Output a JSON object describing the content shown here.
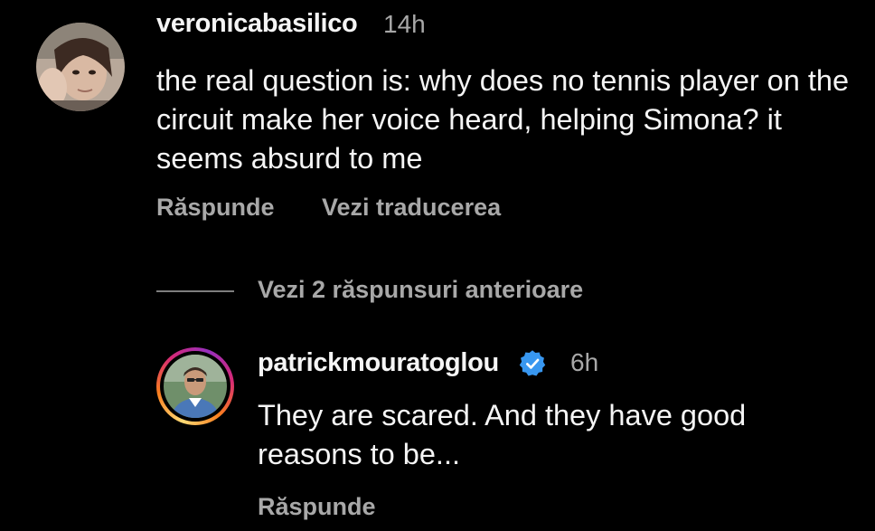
{
  "comment": {
    "username": "veronicabasilico",
    "time": "14h",
    "text": "the real question is: why does no tennis player on the circuit make her voice heard, helping Simona? it seems absurd to me",
    "reply_label": "Răspunde",
    "translate_label": "Vezi traducerea"
  },
  "view_previous_replies": "Vezi 2 răspunsuri anterioare",
  "reply": {
    "username": "patrickmouratoglou",
    "verified": true,
    "time": "6h",
    "text": "They are scared. And they have good reasons to be...",
    "reply_label": "Răspunde"
  },
  "colors": {
    "background": "#000000",
    "primary_text": "#f5f5f5",
    "secondary_text": "#a8a8a8",
    "verified_badge": "#3897f0"
  },
  "icons": {
    "verified": "verified-badge-icon"
  }
}
